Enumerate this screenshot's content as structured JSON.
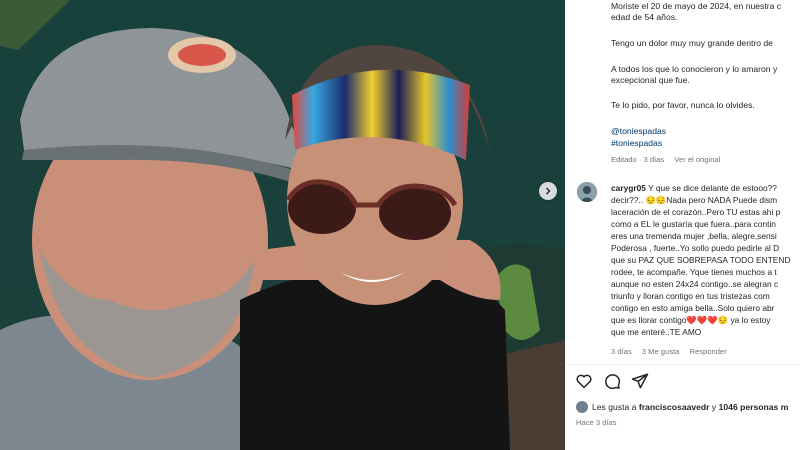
{
  "caption": {
    "lines": [
      "Moriste el 20 de mayo de 2024, en nuestra c",
      "edad de 54 años.",
      "",
      "Tengo un dolor muy muy grande dentro de",
      "",
      "A todos los que lo conocieron y lo amaron y",
      "excepcional que fue.",
      "",
      "Te lo pido, por favor, nunca lo olvides."
    ],
    "hashtags": [
      "@toniespadas",
      "#toniespadas"
    ],
    "meta": {
      "edited": "Editado · 3 días",
      "see_original": "Ver el original"
    }
  },
  "comment": {
    "username": "carygr05",
    "lines": [
      "Y que se dice delante de estooo??",
      "decir??.. 😔😔Nada pero NADA Puede dism",
      "laceración de el corazón..Pero TU estas ahi p",
      "como a EL le gustaría que fuera..para contin",
      "eres una tremenda mujer ,bella, alegre,sensi",
      "Poderosa , fuerte..Yo sollo puedo pedirle al D",
      "que su PAZ QUE SOBREPASA TODO ENTEND",
      "rodee, te acompañe. Yque tienes muchos a t",
      "aunque no esten 24x24 contigo..se alegran c",
      "triunfo y lloran contigo en tus tristezas com",
      "contigo en esto amiga bella..Solo quiero abr",
      "que es llorar contigo❤️❤️❤️😔 ya lo estoy",
      "que me enteré..TE AMO"
    ],
    "meta": {
      "age": "3 días",
      "likes": "3 Me gusta",
      "reply": "Responder"
    }
  },
  "actions": {
    "like_icon": "heart-icon",
    "comment_icon": "comment-icon",
    "share_icon": "share-icon"
  },
  "likes": {
    "prefix": "Les gusta a ",
    "user": "franciscosaavedr",
    "middle": " y ",
    "count": "1046 personas m"
  },
  "posted": "Hace 3 días",
  "colors": {
    "link": "#00376b",
    "muted": "#737373",
    "text": "#262626"
  }
}
